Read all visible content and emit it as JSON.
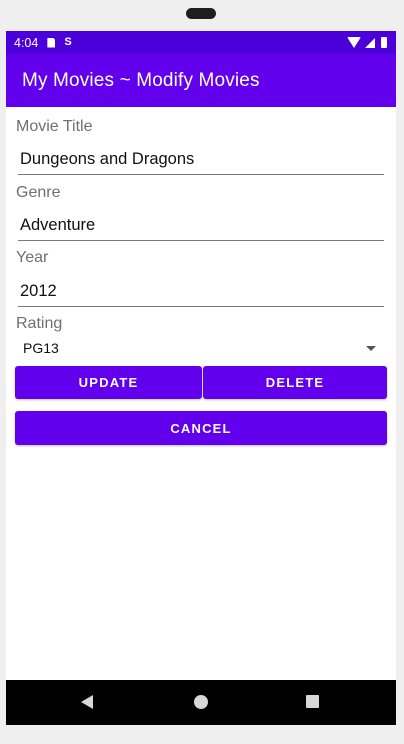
{
  "status_bar": {
    "time": "4:04",
    "icons": [
      "sim-card-icon",
      "s-notification-icon",
      "wifi-icon",
      "cellular-signal-icon",
      "battery-icon"
    ]
  },
  "app_bar": {
    "title": "My Movies ~ Modify Movies",
    "color": "#6200ee"
  },
  "form": {
    "movie_title": {
      "label": "Movie Title",
      "value": "Dungeons and Dragons"
    },
    "genre": {
      "label": "Genre",
      "value": "Adventure"
    },
    "year": {
      "label": "Year",
      "value": "2012"
    },
    "rating": {
      "label": "Rating",
      "selected": "PG13"
    }
  },
  "buttons": {
    "update": "UPDATE",
    "delete": "DELETE",
    "cancel": "CANCEL"
  },
  "nav_bar": {
    "icons": [
      "back-icon",
      "home-icon",
      "recents-icon"
    ]
  }
}
